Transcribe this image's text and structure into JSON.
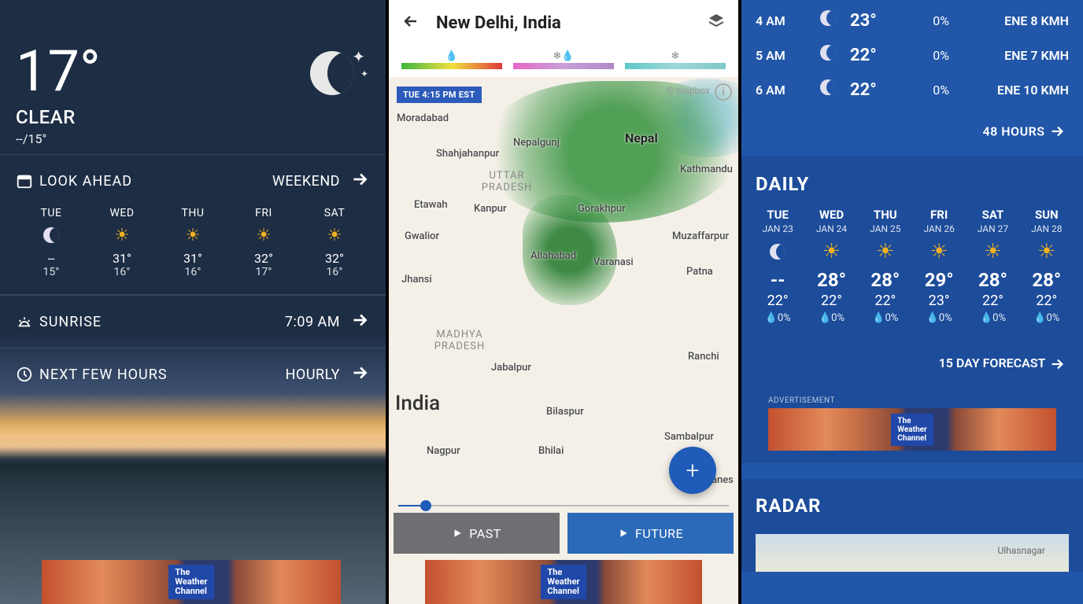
{
  "panel1": {
    "current": {
      "temp": "17°",
      "condition": "CLEAR",
      "hilo": "--/15°"
    },
    "lookAhead": {
      "label": "LOOK AHEAD",
      "link": "WEEKEND"
    },
    "forecast": [
      {
        "day": "TUE",
        "icon": "moon",
        "hi": "--",
        "lo": "15°"
      },
      {
        "day": "WED",
        "icon": "sun",
        "hi": "31°",
        "lo": "16°"
      },
      {
        "day": "THU",
        "icon": "sun",
        "hi": "31°",
        "lo": "16°"
      },
      {
        "day": "FRI",
        "icon": "partly",
        "hi": "32°",
        "lo": "17°"
      },
      {
        "day": "SAT",
        "icon": "sun",
        "hi": "32°",
        "lo": "16°"
      }
    ],
    "sunrise": {
      "label": "SUNRISE",
      "value": "7:09 AM"
    },
    "nextHours": {
      "label": "NEXT FEW HOURS",
      "link": "HOURLY"
    },
    "ad": "The Weather Channel"
  },
  "panel2": {
    "title": "New Delhi, India",
    "timestamp": "TUE 4:15 PM EST",
    "mapbox": "© mapbox",
    "buttons": {
      "past": "PAST",
      "future": "FUTURE"
    },
    "country": "India",
    "places": {
      "nepal": "Nepal",
      "nepalgunj": "Nepalgunj",
      "shahjahanpur": "Shahjahanpur",
      "moradabad": "Moradabad",
      "uttarPradesh": "UTTAR PRADESH",
      "kathmandu": "Kathmandu",
      "etawah": "Etawah",
      "kanpur": "Kanpur",
      "gorakhpur": "Gorakhpur",
      "gwalior": "Gwalior",
      "allahabad": "Allahabad",
      "varanasi": "Varanasi",
      "muzaffarpur": "Muzaffarpur",
      "jhansi": "Jhansi",
      "patna": "Patna",
      "madhyaPradesh": "MADHYA PRADESH",
      "jabalpur": "Jabalpur",
      "ranchi": "Ranchi",
      "bilaspur": "Bilaspur",
      "nagpur": "Nagpur",
      "bhilai": "Bhilai",
      "sambalpur": "Sambalpur",
      "bhubanes": "Bhubanes"
    },
    "ad": "The Weather Channel"
  },
  "panel3": {
    "hourly": [
      {
        "time": "4 AM",
        "icon": "moon",
        "temp": "23°",
        "pct": "0%",
        "wind": "ENE 8 KMH"
      },
      {
        "time": "5 AM",
        "icon": "moon",
        "temp": "22°",
        "pct": "0%",
        "wind": "ENE 7 KMH"
      },
      {
        "time": "6 AM",
        "icon": "moon",
        "temp": "22°",
        "pct": "0%",
        "wind": "ENE 10 KMH"
      }
    ],
    "link48": "48 HOURS",
    "dailyTitle": "DAILY",
    "daily": [
      {
        "day": "TUE",
        "date": "JAN 23",
        "icon": "moon",
        "hi": "--",
        "lo": "22°",
        "pct": "0%"
      },
      {
        "day": "WED",
        "date": "JAN 24",
        "icon": "sun",
        "hi": "28°",
        "lo": "22°",
        "pct": "0%"
      },
      {
        "day": "THU",
        "date": "JAN 25",
        "icon": "sun",
        "hi": "28°",
        "lo": "22°",
        "pct": "0%"
      },
      {
        "day": "FRI",
        "date": "JAN 26",
        "icon": "partly",
        "hi": "29°",
        "lo": "23°",
        "pct": "0%"
      },
      {
        "day": "SAT",
        "date": "JAN 27",
        "icon": "sun",
        "hi": "28°",
        "lo": "22°",
        "pct": "0%"
      },
      {
        "day": "SUN",
        "date": "JAN 28",
        "icon": "sun",
        "hi": "28°",
        "lo": "22°",
        "pct": "0%"
      }
    ],
    "link15": "15 DAY FORECAST",
    "advertLabel": "ADVERTISEMENT",
    "ad": "The Weather Channel",
    "radarTitle": "RADAR",
    "radarPlace": "Ulhasnagar"
  }
}
